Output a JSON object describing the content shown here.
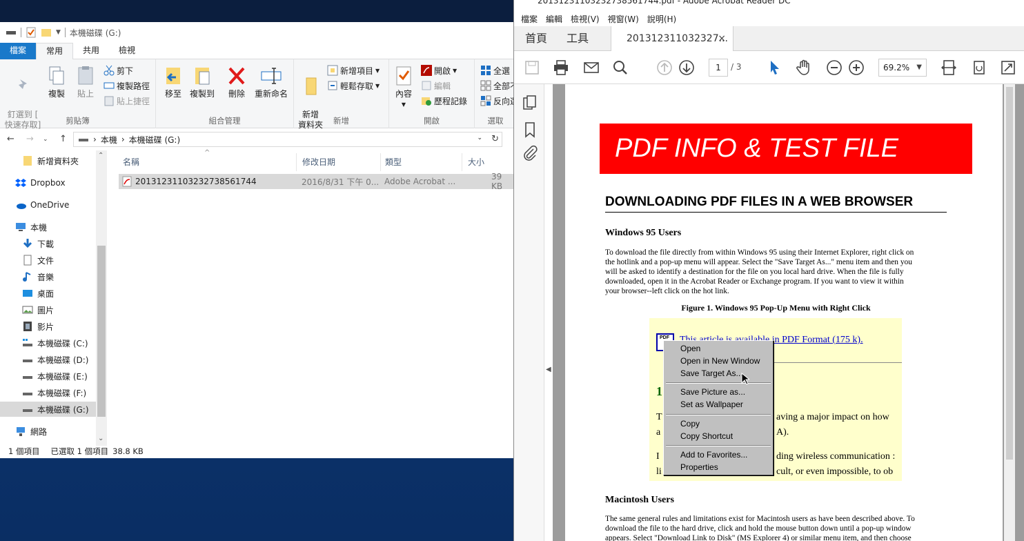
{
  "explorer": {
    "qat_title": "本機磁碟 (G:)",
    "tabs": [
      "檔案",
      "常用",
      "共用",
      "檢視"
    ],
    "ribbon": {
      "clipboard": {
        "pin": "釘選到 [\n快速存取]",
        "copy": "複製",
        "paste": "貼上",
        "cut": "剪下",
        "copy_path": "複製路徑",
        "paste_shortcut": "貼上捷徑",
        "label": "剪貼簿"
      },
      "organize": {
        "move_to": "移至",
        "copy_to": "複製到",
        "delete": "刪除",
        "rename": "重新命名",
        "label": "組合管理"
      },
      "new": {
        "new_folder": "新增\n資料夾",
        "new_item": "新增項目",
        "easy_access": "輕鬆存取",
        "label": "新增"
      },
      "open": {
        "properties": "內容",
        "open": "開啟",
        "edit": "編輯",
        "history": "歷程記錄",
        "label": "開啟"
      },
      "select": {
        "select_all": "全選",
        "select_none": "全部不",
        "invert": "反向選",
        "label": "選取"
      }
    },
    "address": {
      "pc": "本機",
      "drive": "本機磁碟 (G:)"
    },
    "nav": [
      {
        "label": "新增資料夾",
        "icon": "folder-icon"
      },
      {
        "label": "Dropbox",
        "icon": "dropbox-icon"
      },
      {
        "label": "OneDrive",
        "icon": "onedrive-icon"
      },
      {
        "label": "本機",
        "icon": "pc-icon"
      },
      {
        "label": "下載",
        "icon": "download-icon"
      },
      {
        "label": "文件",
        "icon": "document-icon"
      },
      {
        "label": "音樂",
        "icon": "music-icon"
      },
      {
        "label": "桌面",
        "icon": "desktop-icon"
      },
      {
        "label": "圖片",
        "icon": "picture-icon"
      },
      {
        "label": "影片",
        "icon": "video-icon"
      },
      {
        "label": "本機磁碟 (C:)",
        "icon": "drive-icon"
      },
      {
        "label": "本機磁碟 (D:)",
        "icon": "drive-icon"
      },
      {
        "label": "本機磁碟 (E:)",
        "icon": "drive-icon"
      },
      {
        "label": "本機磁碟 (F:)",
        "icon": "drive-icon"
      },
      {
        "label": "本機磁碟 (G:)",
        "icon": "drive-icon"
      },
      {
        "label": "網路",
        "icon": "network-icon"
      }
    ],
    "columns": [
      "名稱",
      "修改日期",
      "類型",
      "大小"
    ],
    "files": [
      {
        "name": "20131231103232738561744",
        "date": "2016/8/31 下午 0...",
        "type": "Adobe Acrobat ...",
        "size": "39 KB"
      }
    ],
    "status": {
      "count": "1 個項目",
      "selected": "已選取 1 個項目",
      "size": "38.8 KB"
    }
  },
  "acrobat": {
    "title": "20131231103232738561744.pdf - Adobe Acrobat Reader DC",
    "menu": [
      "檔案",
      "編輯",
      "檢視(V)",
      "視窗(W)",
      "說明(H)"
    ],
    "tabs": {
      "home": "首頁",
      "tools": "工具",
      "doc": "201312311032327..."
    },
    "toolbar": {
      "page": "1",
      "total": "/ 3",
      "zoom": "69.2%"
    },
    "pdf": {
      "banner": "PDF INFO & TEST FILE",
      "heading": "DOWNLOADING PDF FILES IN A WEB BROWSER",
      "win95_heading": "Windows 95 Users",
      "win95_lines": [
        "To download the file directly from within Windows 95 using their Internet Explorer, right click on",
        "the hotlink and a pop-up menu will appear. Select the \"Save Target As...\" menu item and then you",
        "will be asked to identify a destination for the file on you local hard drive. When the file is fully",
        "downloaded, open it in the Acrobat Reader or Exchange program. If you want to view it within",
        "your browser--left click on the hot link."
      ],
      "figure_caption": "Figure 1. Windows 95 Pop-Up Menu with Right Click",
      "figure": {
        "link": "This article is available in PDF Format (175 k).",
        "lines": [
          "1",
          "T",
          "aving a major impact on how",
          "a",
          "A).",
          "I",
          "ding wireless communication :",
          "li",
          "cult, or even impossible, to ob"
        ],
        "menu": [
          "Open",
          "Open in New Window",
          "Save Target As...",
          "Save Picture as...",
          "Set as Wallpaper",
          "Copy",
          "Copy Shortcut",
          "Add to Favorites...",
          "Properties"
        ]
      },
      "mac_heading": "Macintosh Users",
      "mac_lines": [
        "The same general rules and limitations exist for Macintosh users as have been described above. To",
        "download the file to the hard drive, click and hold the mouse button down until a pop-up window",
        "appears. Select \"Download Link to Disk\" (MS Explorer 4) or similar menu item, and then choose"
      ]
    }
  },
  "colors": {
    "file_tab": "#1979ca",
    "banner": "#ff0000",
    "figure_bg": "#ffffcc",
    "link": "#0000cc"
  }
}
